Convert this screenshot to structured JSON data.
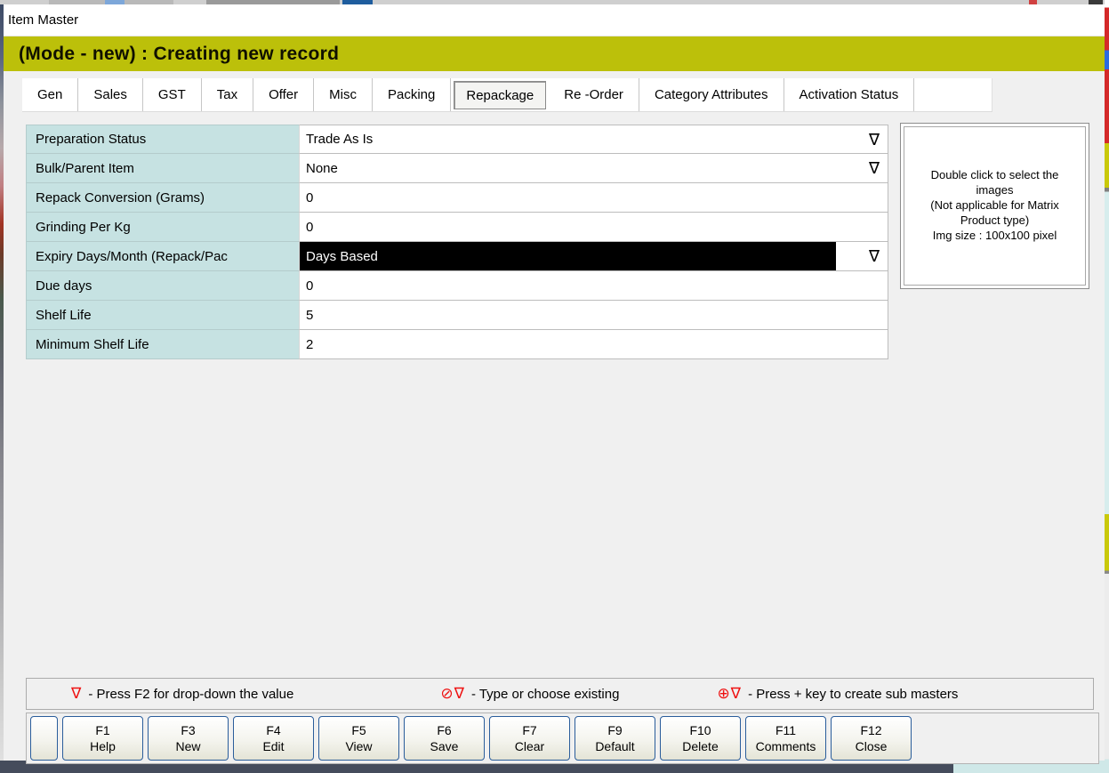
{
  "window": {
    "title": "Item Master",
    "mode_banner": "(Mode - new) : Creating new record"
  },
  "tabs": [
    {
      "label": "Gen"
    },
    {
      "label": "Sales"
    },
    {
      "label": "GST"
    },
    {
      "label": "Tax"
    },
    {
      "label": "Offer"
    },
    {
      "label": "Misc"
    },
    {
      "label": "Packing"
    },
    {
      "label": "Repackage",
      "selected": true
    },
    {
      "label": "Re -Order"
    },
    {
      "label": "Category Attributes"
    },
    {
      "label": "Activation Status"
    }
  ],
  "form": {
    "dropdown_glyph": "∇",
    "rows": [
      {
        "label": "Preparation Status",
        "value": "Trade As Is",
        "dropdown": true
      },
      {
        "label": "Bulk/Parent Item",
        "value": "None",
        "dropdown": true
      },
      {
        "label": "Repack Conversion (Grams)",
        "value": "0",
        "dropdown": false
      },
      {
        "label": "Grinding Per Kg",
        "value": "0",
        "dropdown": false
      },
      {
        "label": "Expiry Days/Month (Repack/Pac",
        "value": "Days Based",
        "dropdown": true,
        "highlighted": true
      },
      {
        "label": "Due days",
        "value": "0",
        "dropdown": false
      },
      {
        "label": "Shelf Life",
        "value": "5",
        "dropdown": false
      },
      {
        "label": "Minimum Shelf Life",
        "value": "2",
        "dropdown": false
      }
    ]
  },
  "image_panel": {
    "line1": "Double click to select the images",
    "line2": "(Not applicable for Matrix Product type)",
    "line3": "Img size : 100x100 pixel"
  },
  "legend": {
    "items": [
      {
        "symbol": "∇",
        "text": "- Press F2 for drop-down the value"
      },
      {
        "symbol": "⊘∇",
        "text": "- Type or choose existing"
      },
      {
        "symbol": "⊕∇",
        "text": "- Press + key to create sub masters"
      }
    ]
  },
  "toolbar": {
    "buttons": [
      {
        "key": "F1",
        "label": "Help"
      },
      {
        "key": "F3",
        "label": "New"
      },
      {
        "key": "F4",
        "label": "Edit"
      },
      {
        "key": "F5",
        "label": "View"
      },
      {
        "key": "F6",
        "label": "Save"
      },
      {
        "key": "F7",
        "label": "Clear"
      },
      {
        "key": "F9",
        "label": "Default"
      },
      {
        "key": "F10",
        "label": "Delete"
      },
      {
        "key": "F11",
        "label": "Comments"
      },
      {
        "key": "F12",
        "label": "Close"
      }
    ]
  },
  "colors": {
    "banner_bg": "#bcc00a",
    "label_bg": "#c6e2e2",
    "highlight_bg": "#000000",
    "highlight_text": "#ffffff",
    "legend_symbol": "#ee1111",
    "button_border": "#2a5d9b",
    "bottom_strip": "#454c5c"
  }
}
